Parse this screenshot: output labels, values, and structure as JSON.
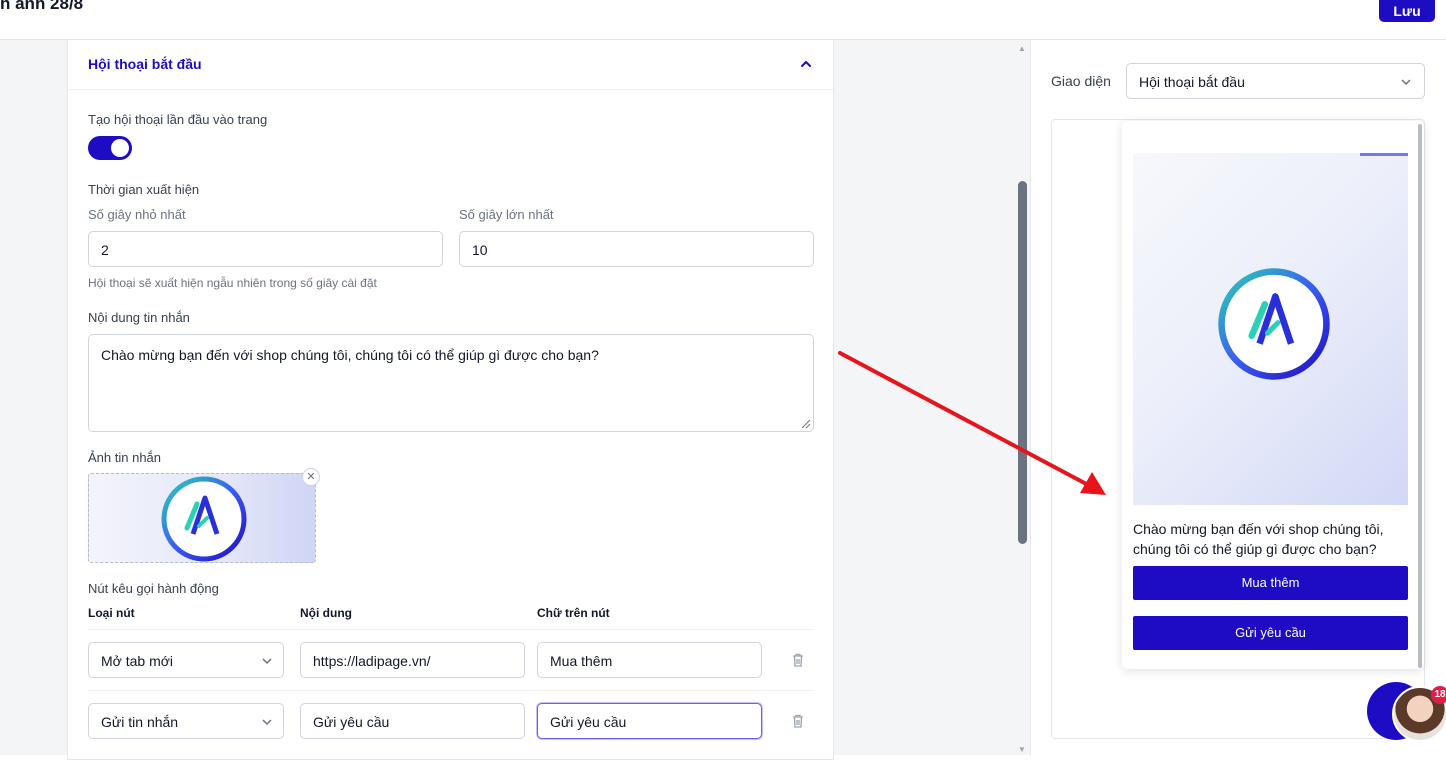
{
  "header": {
    "title": "h ảnh 28/8",
    "save_label": "Lưu"
  },
  "section": {
    "title": "Hội thoại bắt đầu",
    "auto_open_label": "Tạo hội thoại lần đầu vào trang",
    "auto_open_enabled": true,
    "timing_label": "Thời gian xuất hiện",
    "min_label": "Số giây nhỏ nhất",
    "min_value": "2",
    "max_label": "Số giây lớn nhất",
    "max_value": "10",
    "timing_hint": "Hội thoại sẽ xuất hiện ngẫu nhiên trong số giây cài đặt",
    "message_label": "Nội dung tin nhắn",
    "message_value": "Chào mừng bạn đến với shop chúng tôi, chúng tôi có thể giúp gì được cho bạn?",
    "image_label": "Ảnh tin nhắn",
    "cta_label": "Nút kêu gọi hành động",
    "columns": [
      "Loại nút",
      "Nội dung",
      "Chữ trên nút"
    ],
    "rows": [
      {
        "type": "Mở tab mới",
        "content": "https://ladipage.vn/",
        "button_text": "Mua thêm"
      },
      {
        "type": "Gửi tin nhắn",
        "content": "Gửi yêu cầu",
        "button_text": "Gửi yêu cầu"
      }
    ]
  },
  "preview": {
    "label": "Giao diện",
    "selected": "Hội thoại bắt đầu",
    "message": "Chào mừng bạn đến với shop chúng tôi, chúng tôi có thể giúp gì được cho bạn?",
    "buttons": [
      "Mua thêm",
      "Gửi yêu cầu"
    ]
  },
  "chat_widget": {
    "badge": "18"
  },
  "colors": {
    "accent": "#1e0bc4",
    "arrow": "#e8141c"
  }
}
